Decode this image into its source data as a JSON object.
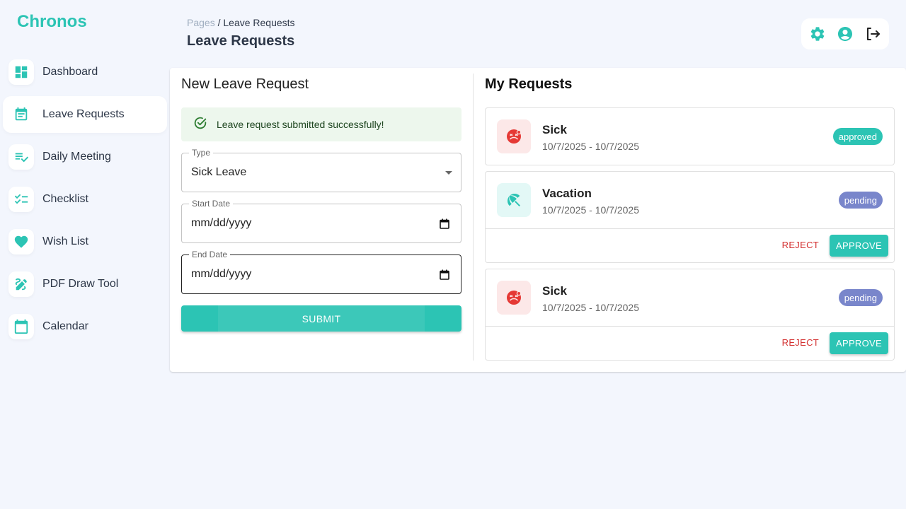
{
  "app": {
    "brand": "Chronos"
  },
  "sidebar": {
    "items": [
      {
        "label": "Dashboard",
        "icon": "dashboard-icon",
        "active": false
      },
      {
        "label": "Leave Requests",
        "icon": "event-note-icon",
        "active": true
      },
      {
        "label": "Daily Meeting",
        "icon": "playlist-check-icon",
        "active": false
      },
      {
        "label": "Checklist",
        "icon": "checklist-icon",
        "active": false
      },
      {
        "label": "Wish List",
        "icon": "heart-icon",
        "active": false
      },
      {
        "label": "PDF Draw Tool",
        "icon": "draw-icon",
        "active": false
      },
      {
        "label": "Calendar",
        "icon": "calendar-icon",
        "active": false
      }
    ]
  },
  "header": {
    "breadcrumb_root": "Pages",
    "breadcrumb_sep": " / ",
    "breadcrumb_current": "Leave Requests",
    "title": "Leave Requests",
    "actions": [
      "settings-icon",
      "account-icon",
      "logout-icon"
    ]
  },
  "form": {
    "title": "New Leave Request",
    "alert": "Leave request submitted successfully!",
    "type_label": "Type",
    "type_value": "Sick Leave",
    "start_label": "Start Date",
    "start_value": "mm/dd/yyyy",
    "end_label": "End Date",
    "end_value": "mm/dd/yyyy",
    "submit_label": "SUBMIT"
  },
  "requests": {
    "title": "My Requests",
    "items": [
      {
        "name": "Sick",
        "dates": "10/7/2025 - 10/7/2025",
        "status": "approved",
        "icon": "sick-face-icon"
      },
      {
        "name": "Vacation",
        "dates": "10/7/2025 - 10/7/2025",
        "status": "pending",
        "icon": "beach-umbrella-icon",
        "reject_label": "REJECT",
        "approve_label": "APPROVE"
      },
      {
        "name": "Sick",
        "dates": "10/7/2025 - 10/7/2025",
        "status": "pending",
        "icon": "sick-face-icon",
        "reject_label": "REJECT",
        "approve_label": "APPROVE"
      }
    ]
  },
  "colors": {
    "accent": "#2cc4b4",
    "pending": "#7986cb",
    "reject": "#d32f2f",
    "background": "#f3f6fd"
  }
}
